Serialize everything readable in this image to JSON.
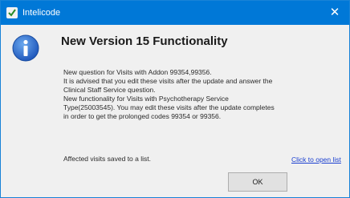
{
  "window": {
    "title": "Intelicode",
    "close_glyph": "✕",
    "accent_color": "#0078d7"
  },
  "dialog": {
    "icon": "info-icon",
    "heading": "New Version 15 Functionality",
    "message_lines": [
      "New question for Visits with Addon 99354,99356.",
      "It is advised that you edit these visits after the update and answer the Clinical Staff Service question.",
      "New functionality for Visits with Psychotherapy Service Type(25003545). You may edit these visits after the update completes in order to get the prolonged codes 99354 or 99356."
    ],
    "affected_text": "Affected visits saved to a list.",
    "link_text": "Click to open list",
    "ok_label": "OK"
  }
}
